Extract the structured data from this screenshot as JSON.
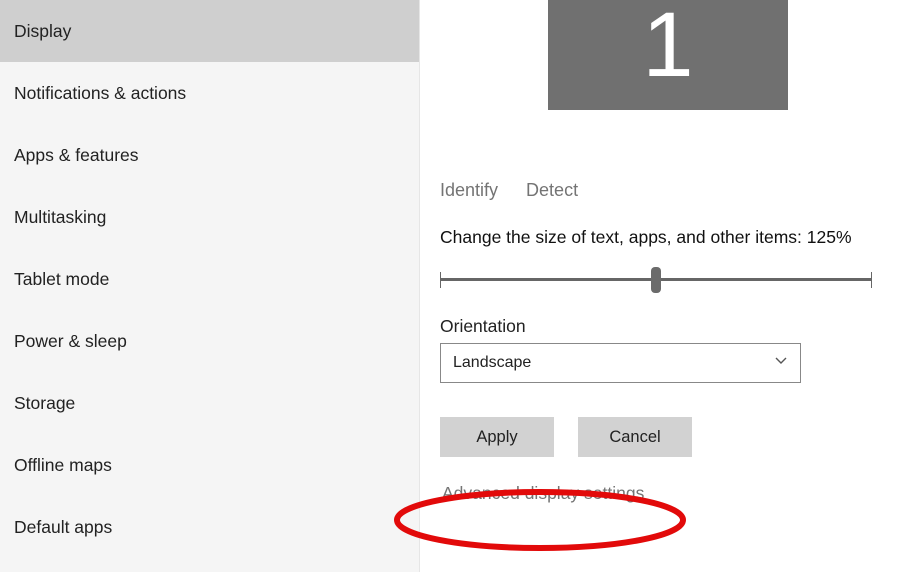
{
  "sidebar": {
    "items": [
      {
        "label": "Display",
        "selected": true
      },
      {
        "label": "Notifications & actions",
        "selected": false
      },
      {
        "label": "Apps & features",
        "selected": false
      },
      {
        "label": "Multitasking",
        "selected": false
      },
      {
        "label": "Tablet mode",
        "selected": false
      },
      {
        "label": "Power & sleep",
        "selected": false
      },
      {
        "label": "Storage",
        "selected": false
      },
      {
        "label": "Offline maps",
        "selected": false
      },
      {
        "label": "Default apps",
        "selected": false
      }
    ]
  },
  "display": {
    "monitor_number": "1",
    "identify": "Identify",
    "detect": "Detect",
    "scale_label": "Change the size of text, apps, and other items: 125%",
    "slider_position_percent": 50,
    "orientation_label": "Orientation",
    "orientation_value": "Landscape",
    "apply": "Apply",
    "cancel": "Cancel",
    "advanced_link": "Advanced display settings"
  },
  "highlight": {
    "color": "#e20a0a"
  }
}
